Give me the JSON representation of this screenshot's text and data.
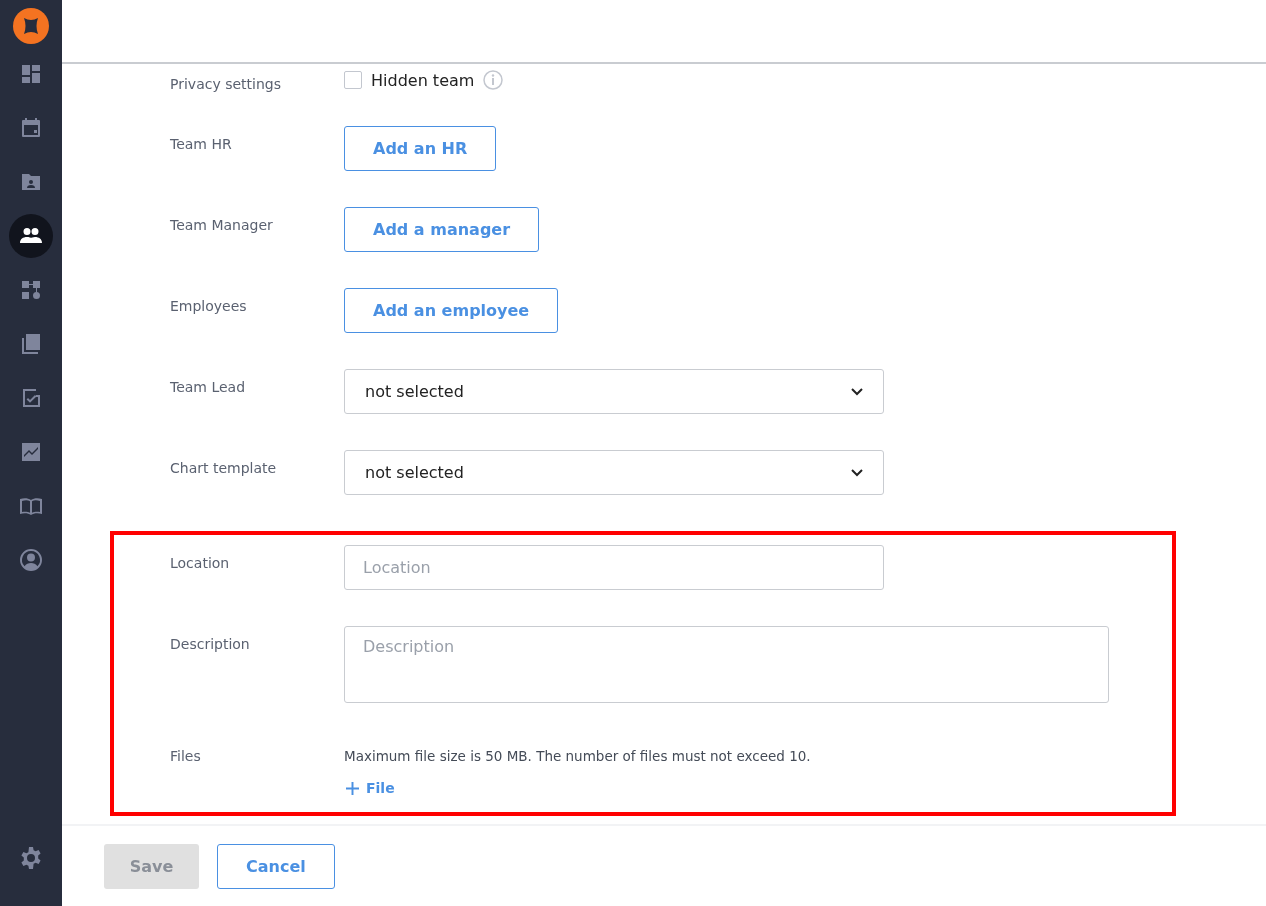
{
  "sidebar": {
    "items": [
      {
        "selected": false
      },
      {
        "selected": false
      },
      {
        "selected": false
      },
      {
        "selected": true
      },
      {
        "selected": false
      },
      {
        "selected": false
      },
      {
        "selected": false
      },
      {
        "selected": false
      },
      {
        "selected": false
      },
      {
        "selected": false
      }
    ]
  },
  "form": {
    "rows": [
      {
        "kind": "checkbox",
        "label": "Privacy settings",
        "text": "Hidden team",
        "checked": false
      },
      {
        "kind": "button",
        "label": "Team HR",
        "text": "Add an HR"
      },
      {
        "kind": "button",
        "label": "Team Manager",
        "text": "Add a manager"
      },
      {
        "kind": "button",
        "label": "Employees",
        "text": "Add an employee"
      },
      {
        "kind": "select",
        "label": "Team Lead",
        "value": "not selected"
      },
      {
        "kind": "select",
        "label": "Chart template",
        "value": "not selected"
      }
    ],
    "highlighted_rows": [
      {
        "kind": "input",
        "label": "Location",
        "placeholder": "Location"
      },
      {
        "kind": "textarea",
        "label": "Description",
        "placeholder": "Description"
      },
      {
        "kind": "files",
        "label": "Files",
        "note": "Maximum file size is 50 MB. The number of files must not exceed 10.",
        "action": "File"
      }
    ]
  },
  "footer": {
    "save": {
      "label": "Save",
      "disabled": true
    },
    "cancel": {
      "label": "Cancel"
    }
  }
}
